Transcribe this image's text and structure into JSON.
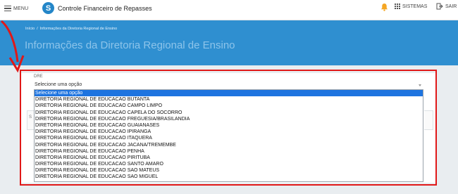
{
  "topbar": {
    "menu_label": "MENU",
    "app_title": "Controle Financeiro de Repasses",
    "logo_letter": "S",
    "systems_label": "SISTEMAS",
    "logout_label": "SAIR",
    "bell_color": "#f5a623"
  },
  "breadcrumb": {
    "home": "Início",
    "separator": "/",
    "current": "Informações da Diretoria Regional de Ensino"
  },
  "page": {
    "title": "Informações da Diretoria Regional de Ensino"
  },
  "form": {
    "dre_label": "DRE",
    "selected_value": "Selecione uma opção",
    "options": [
      "Selecione uma opção",
      "DIRETORIA REGIONAL DE EDUCACAO BUTANTA",
      "DIRETORIA REGIONAL DE EDUCACAO CAMPO LIMPO",
      "DIRETORIA REGIONAL DE EDUCACAO CAPELA DO SOCORRO",
      "DIRETORIA REGIONAL DE EDUCACAO FREGUESIA/BRASILANDIA",
      "DIRETORIA REGIONAL DE EDUCACAO GUAIANASES",
      "DIRETORIA REGIONAL DE EDUCACAO IPIRANGA",
      "DIRETORIA REGIONAL DE EDUCACAO ITAQUERA",
      "DIRETORIA REGIONAL DE EDUCACAO JACANA/TREMEMBE",
      "DIRETORIA REGIONAL DE EDUCACAO PENHA",
      "DIRETORIA REGIONAL DE EDUCACAO PIRITUBA",
      "DIRETORIA REGIONAL DE EDUCACAO SANTO AMARO",
      "DIRETORIA REGIONAL DE EDUCACAO SAO MATEUS",
      "DIRETORIA REGIONAL DE EDUCACAO SAO MIGUEL"
    ],
    "highlighted_index": 0,
    "background_fragment": "S"
  },
  "colors": {
    "header_blue": "#2f8fd0",
    "highlight_blue": "#1e74e0",
    "annotation_red": "#e01818"
  }
}
